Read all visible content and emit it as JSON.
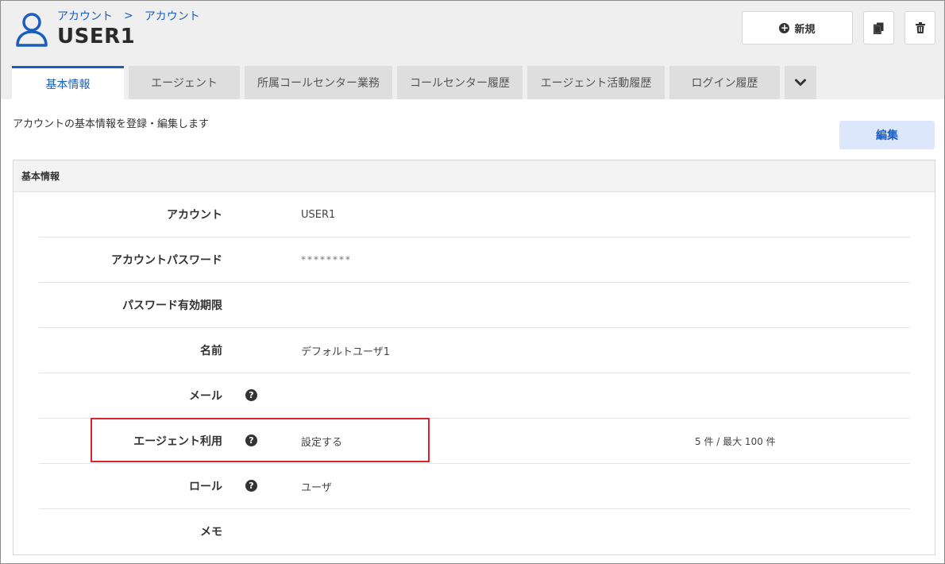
{
  "breadcrumb": [
    "アカウント",
    "アカウント"
  ],
  "breadcrumb_separator": ">",
  "page_title": "USER1",
  "toolbar": {
    "new_label": "新規",
    "new_icon": "plus-circle-icon",
    "copy_icon": "copy-icon",
    "delete_icon": "trash-icon"
  },
  "tabs": [
    {
      "label": "基本情報",
      "active": true
    },
    {
      "label": "エージェント",
      "active": false
    },
    {
      "label": "所属コールセンター業務",
      "active": false
    },
    {
      "label": "コールセンター履歴",
      "active": false
    },
    {
      "label": "エージェント活動履歴",
      "active": false
    },
    {
      "label": "ログイン履歴",
      "active": false
    }
  ],
  "tab_more_icon": "chevron-down-icon",
  "description": "アカウントの基本情報を登録・編集します",
  "edit_label": "編集",
  "panel": {
    "title": "基本情報",
    "rows": [
      {
        "label": "アカウント",
        "value": "USER1",
        "help": false,
        "extra": ""
      },
      {
        "label": "アカウントパスワード",
        "value": "********",
        "help": false,
        "extra": ""
      },
      {
        "label": "パスワード有効期限",
        "value": "",
        "help": false,
        "extra": ""
      },
      {
        "label": "名前",
        "value": "デフォルトユーザ1",
        "help": false,
        "extra": ""
      },
      {
        "label": "メール",
        "value": "",
        "help": true,
        "extra": ""
      },
      {
        "label": "エージェント利用",
        "value": "設定する",
        "help": true,
        "extra": "5 件 / 最大 100 件"
      },
      {
        "label": "ロール",
        "value": "ユーザ",
        "help": true,
        "extra": ""
      },
      {
        "label": "メモ",
        "value": "",
        "help": false,
        "extra": ""
      }
    ]
  },
  "colors": {
    "accent": "#1a5fbf",
    "highlight": "#d9242b",
    "topbar": "#efefef",
    "edit_button": "#dde7fb"
  }
}
